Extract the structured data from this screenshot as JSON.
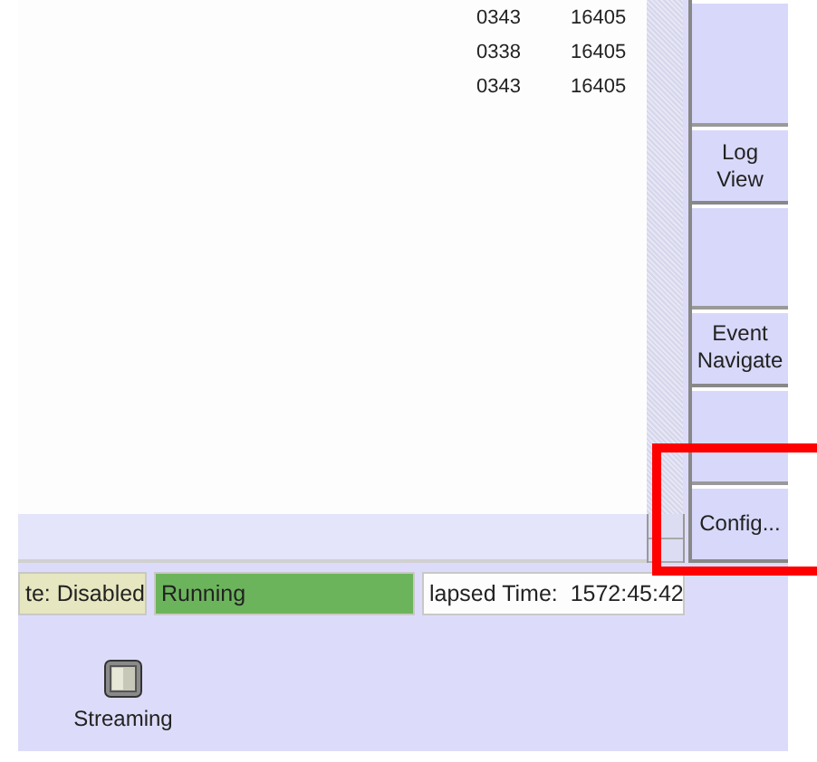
{
  "log_table": {
    "rows": [
      {
        "column_1": "0343",
        "column_2": "16405"
      },
      {
        "column_1": "0338",
        "column_2": "16405"
      },
      {
        "column_1": "0343",
        "column_2": "16405"
      }
    ]
  },
  "side_buttons": [
    {
      "label": "Log\nView",
      "highlighted": false
    },
    {
      "label": "Event\nNavigate",
      "highlighted": false
    },
    {
      "label": "Config...",
      "highlighted": true
    }
  ],
  "status_bar": [
    {
      "text": "te: Disabled",
      "kind": "neutral"
    },
    {
      "text": "Running",
      "kind": "ok"
    },
    {
      "text": "lapsed Time:  1572:45:42",
      "kind": "plain"
    }
  ],
  "desktop_icons": [
    {
      "label": "Streaming"
    }
  ]
}
